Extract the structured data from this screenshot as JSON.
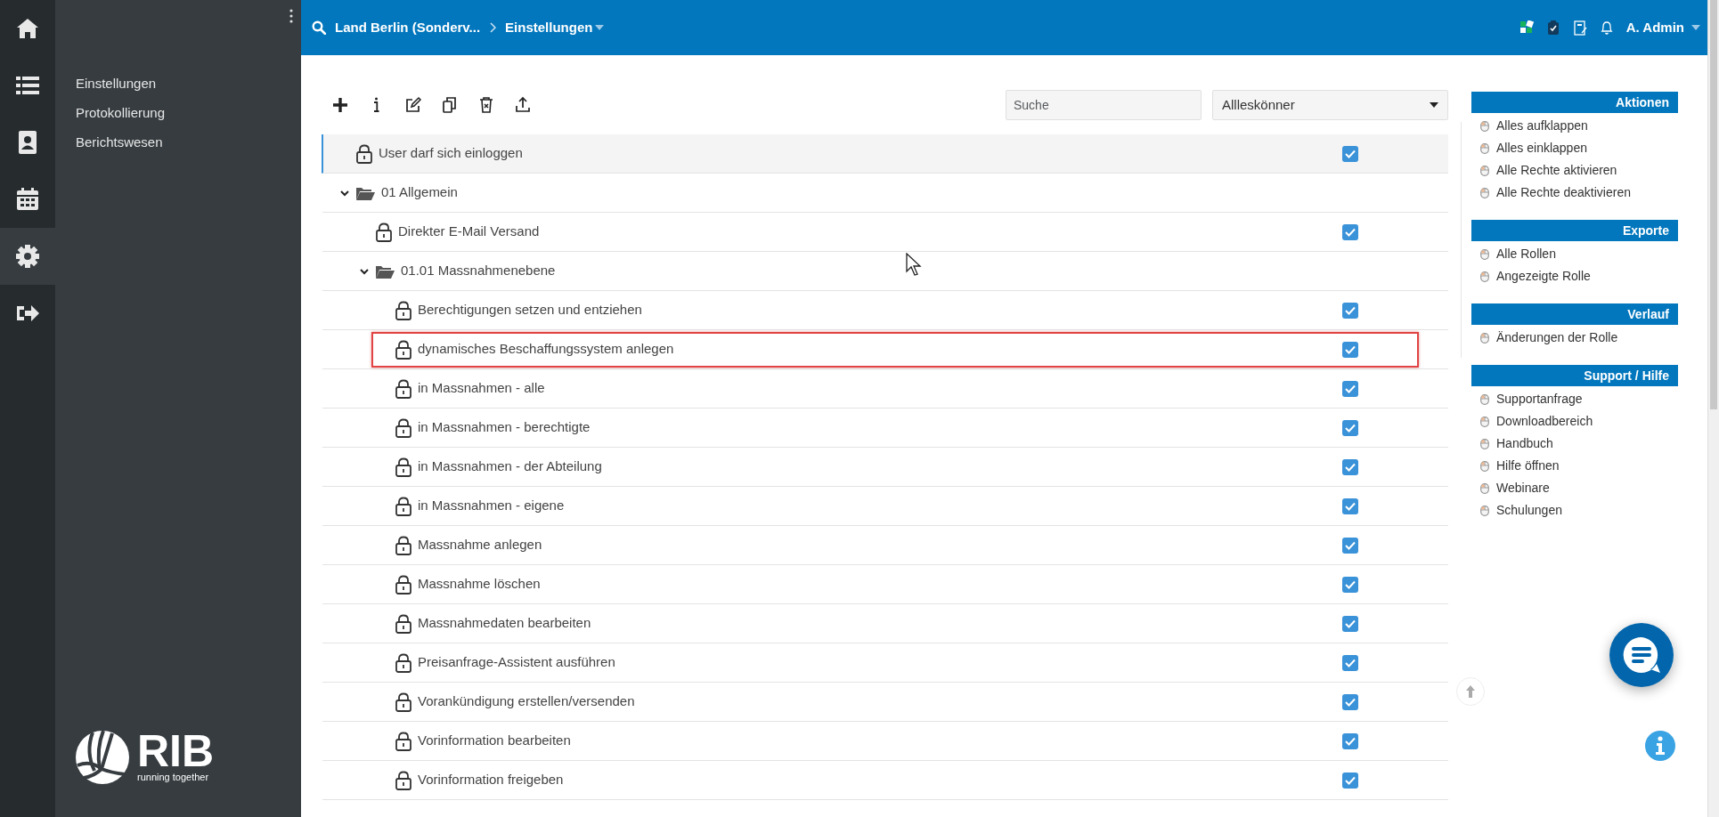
{
  "rail": {
    "items": [
      {
        "selected": false
      },
      {
        "selected": false
      },
      {
        "selected": false
      },
      {
        "selected": false
      },
      {
        "selected": true
      },
      {
        "selected": false
      }
    ]
  },
  "sidebar": {
    "items": [
      {
        "label": "Einstellungen"
      },
      {
        "label": "Protokollierung"
      },
      {
        "label": "Berichtswesen"
      }
    ],
    "logo": {
      "name": "RIB",
      "tagline": "running together"
    }
  },
  "topbar": {
    "breadcrumb": [
      "Land Berlin (Sonderv...",
      "Einstellungen"
    ],
    "user": "A. Admin"
  },
  "toolbar": {
    "search": {
      "placeholder": "Suche"
    },
    "role": {
      "value": "Allleskönner"
    }
  },
  "tree": [
    {
      "label": "User darf sich einloggen",
      "kind": "permission",
      "checked": true,
      "selected": true,
      "highlighted": false
    },
    {
      "label": "01 Allgemein",
      "kind": "folder",
      "expanded": true,
      "selected": false,
      "highlighted": false,
      "children": [
        {
          "label": "Direkter E-Mail Versand",
          "kind": "permission",
          "checked": true,
          "selected": false,
          "highlighted": false
        },
        {
          "label": "01.01 Massnahmenebene",
          "kind": "folder",
          "expanded": true,
          "selected": false,
          "highlighted": false,
          "children": [
            {
              "label": "Berechtigungen setzen und entziehen",
              "kind": "permission",
              "checked": true,
              "selected": false,
              "highlighted": false
            },
            {
              "label": "dynamisches Beschaffungssystem anlegen",
              "kind": "permission",
              "checked": true,
              "selected": false,
              "highlighted": true
            },
            {
              "label": "in Massnahmen - alle",
              "kind": "permission",
              "checked": true,
              "selected": false,
              "highlighted": false
            },
            {
              "label": "in Massnahmen - berechtigte",
              "kind": "permission",
              "checked": true,
              "selected": false,
              "highlighted": false
            },
            {
              "label": "in Massnahmen - der Abteilung",
              "kind": "permission",
              "checked": true,
              "selected": false,
              "highlighted": false
            },
            {
              "label": "in Massnahmen - eigene",
              "kind": "permission",
              "checked": true,
              "selected": false,
              "highlighted": false
            },
            {
              "label": "Massnahme anlegen",
              "kind": "permission",
              "checked": true,
              "selected": false,
              "highlighted": false
            },
            {
              "label": "Massnahme löschen",
              "kind": "permission",
              "checked": true,
              "selected": false,
              "highlighted": false
            },
            {
              "label": "Massnahmedaten bearbeiten",
              "kind": "permission",
              "checked": true,
              "selected": false,
              "highlighted": false
            },
            {
              "label": "Preisanfrage-Assistent ausführen",
              "kind": "permission",
              "checked": true,
              "selected": false,
              "highlighted": false
            },
            {
              "label": "Vorankündigung erstellen/versenden",
              "kind": "permission",
              "checked": true,
              "selected": false,
              "highlighted": false
            },
            {
              "label": "Vorinformation bearbeiten",
              "kind": "permission",
              "checked": true,
              "selected": false,
              "highlighted": false
            },
            {
              "label": "Vorinformation freigeben",
              "kind": "permission",
              "checked": true,
              "selected": false,
              "highlighted": false
            }
          ]
        }
      ]
    }
  ],
  "side_panel": {
    "sections": [
      {
        "title": "Aktionen",
        "items": [
          "Alles aufklappen",
          "Alles einklappen",
          "Alle Rechte aktivieren",
          "Alle Rechte deaktivieren"
        ]
      },
      {
        "title": "Exporte",
        "items": [
          "Alle Rollen",
          "Angezeigte Rolle"
        ]
      },
      {
        "title": "Verlauf",
        "items": [
          "Änderungen der Rolle"
        ]
      },
      {
        "title": "Support / Hilfe",
        "items": [
          "Supportanfrage",
          "Downloadbereich",
          "Handbuch",
          "Hilfe öffnen",
          "Webinare",
          "Schulungen"
        ]
      }
    ]
  }
}
